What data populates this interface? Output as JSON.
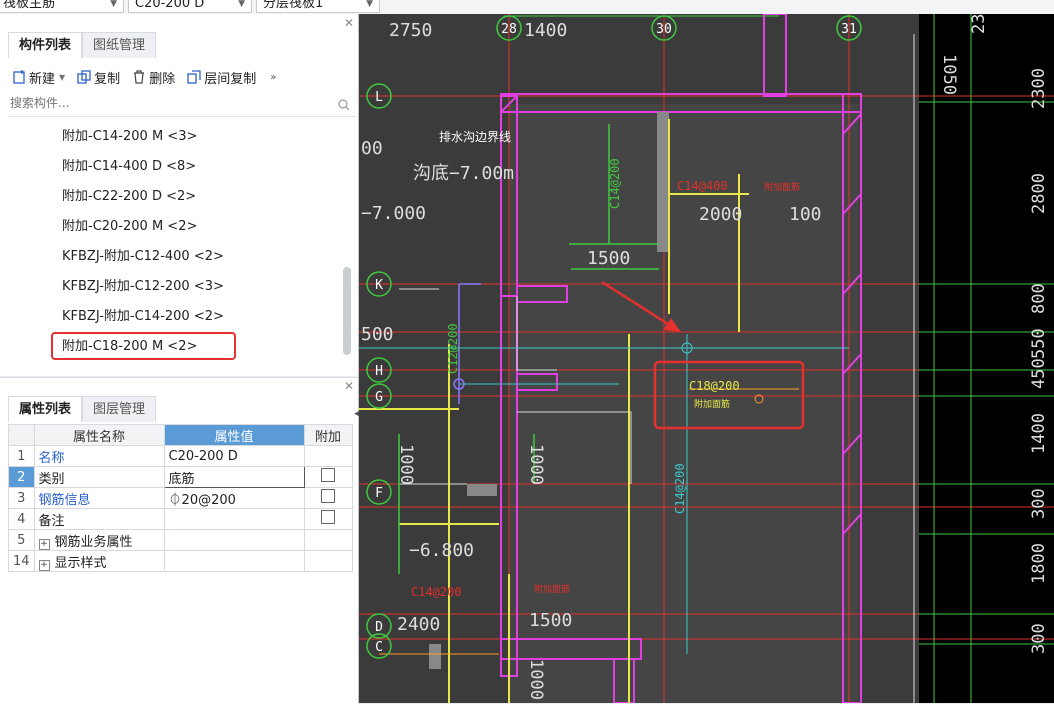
{
  "topbar": {
    "dropdown1": "筏板主筋",
    "dropdown2": "C20-200  D",
    "dropdown3": "分层筏板1"
  },
  "component_panel": {
    "tabs": [
      "构件列表",
      "图纸管理"
    ],
    "toolbar": {
      "new": "新建",
      "copy": "复制",
      "delete": "删除",
      "floor_copy": "层间复制"
    },
    "search_placeholder": "搜索构件...",
    "items": [
      "附加-C14-200  M <3>",
      "附加-C14-400  D <8>",
      "附加-C22-200  D <2>",
      "附加-C20-200   M <2>",
      "KFBZJ-附加-C12-400 <2>",
      "KFBZJ-附加-C12-200 <3>",
      "KFBZJ-附加-C14-200 <2>",
      "附加-C18-200  M <2>"
    ],
    "selected_index": 7
  },
  "property_panel": {
    "tabs": [
      "属性列表",
      "图层管理"
    ],
    "headers": [
      "属性名称",
      "属性值",
      "附加"
    ],
    "rows": [
      {
        "num": "1",
        "name": "名称",
        "value": "C20-200  D",
        "check": false,
        "link": true
      },
      {
        "num": "2",
        "name": "类别",
        "value": "底筋",
        "check": true,
        "link": false
      },
      {
        "num": "3",
        "name": "钢筋信息",
        "value": "⏀20@200",
        "check": true,
        "link": true
      },
      {
        "num": "4",
        "name": "备注",
        "value": "",
        "check": true,
        "link": false
      },
      {
        "num": "5",
        "name": "钢筋业务属性",
        "value": "",
        "check": false,
        "expand": true
      },
      {
        "num": "14",
        "name": "显示样式",
        "value": "",
        "check": false,
        "expand": true
      }
    ]
  },
  "cad": {
    "axis_numbers": [
      "28",
      "30",
      "31"
    ],
    "axis_letters": [
      "L",
      "K",
      "H",
      "G",
      "F",
      "D",
      "C"
    ],
    "dims_top": [
      "2750",
      "1400"
    ],
    "dims_right": [
      "2300",
      "2800",
      "800",
      "550",
      "450",
      "1400",
      "300",
      "1800",
      "300"
    ],
    "dim_1050": "1050",
    "texts": {
      "drain": "排水沟边界线",
      "elev1": "沟底−7.00m",
      "elev2": "−7.000",
      "elev3": "−6.800",
      "val_2000": "2000",
      "val_100": "100",
      "val_1500a": "1500",
      "val_1500b": "1500",
      "val_2400": "2400",
      "val_1000a": "1000",
      "val_1000b": "1000",
      "val_1000c": "1000",
      "val_500": "500",
      "val_00": "00",
      "rebar_c14_400": "C14@400",
      "rebar_c14_200a": "C14@200",
      "rebar_c14_200b": "C14@200",
      "rebar_c14_200c": "C14@200",
      "rebar_c12_200": "C12@200",
      "rebar_c18_200": "C18@200",
      "tag": "附加面筋"
    }
  },
  "colors": {
    "accent": "#5b9bd5",
    "highlight": "#e53030",
    "cad_bg": "#000000",
    "cad_magenta": "#e040e0",
    "cad_yellow": "#e8e84a",
    "cad_green": "#3fc93f",
    "cad_cyan": "#3fc9c9",
    "cad_red": "#e0302a"
  }
}
